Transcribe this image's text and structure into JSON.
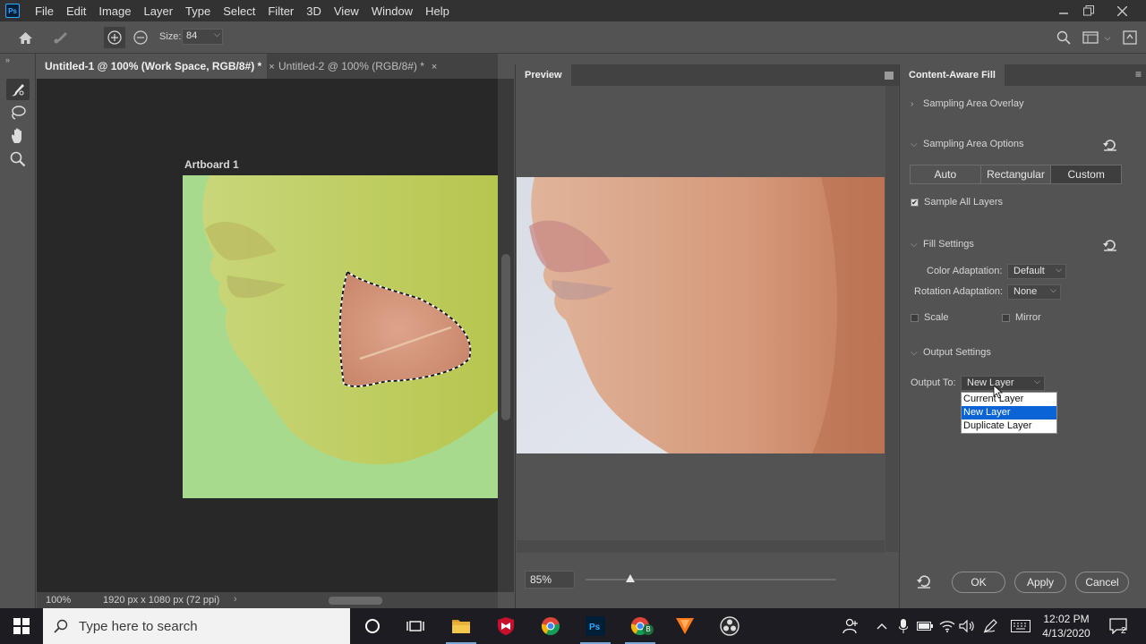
{
  "app": {
    "name": "Ps",
    "menu": [
      "File",
      "Edit",
      "Image",
      "Layer",
      "Type",
      "Select",
      "Filter",
      "3D",
      "View",
      "Window",
      "Help"
    ]
  },
  "options_bar": {
    "size_label": "Size:",
    "size_value": "84"
  },
  "document_tabs": [
    {
      "label": "Untitled-1 @ 100% (Work Space, RGB/8#) *",
      "close": "×"
    },
    {
      "label": "Untitled-2 @ 100% (RGB/8#) *",
      "close": "×"
    }
  ],
  "canvas": {
    "artboard_label": "Artboard 1"
  },
  "status_bar": {
    "zoom": "100%",
    "dimensions": "1920 px x 1080 px (72 ppi)",
    "chevron": "›"
  },
  "preview_panel": {
    "title": "Preview",
    "zoom": "85%",
    "zoom_slider_fraction": 0.18
  },
  "caf_panel": {
    "title": "Content-Aware Fill",
    "sampling_overlay": "Sampling Area Overlay",
    "sampling_options": "Sampling Area Options",
    "sampling_modes": [
      "Auto",
      "Rectangular",
      "Custom"
    ],
    "selected_mode": "Custom",
    "sample_all_layers": "Sample All Layers",
    "sample_all_layers_checked": true,
    "fill_settings": "Fill Settings",
    "color_adaptation_label": "Color Adaptation:",
    "color_adaptation_value": "Default",
    "rotation_adaptation_label": "Rotation Adaptation:",
    "rotation_adaptation_value": "None",
    "scale_label": "Scale",
    "mirror_label": "Mirror",
    "output_settings": "Output Settings",
    "output_to_label": "Output To:",
    "output_to_value": "New Layer",
    "output_options": [
      "Current Layer",
      "New Layer",
      "Duplicate Layer"
    ],
    "output_selected": "New Layer",
    "buttons": {
      "ok": "OK",
      "apply": "Apply",
      "cancel": "Cancel"
    }
  },
  "taskbar": {
    "search_placeholder": "Type here to search",
    "time": "12:02 PM",
    "date": "4/13/2020",
    "notification_count": "2",
    "chrome_badge": "B"
  },
  "colors": {
    "ps_blue": "#31a8ff",
    "selection_highlight": "#0a64d6",
    "artboard_overlay": "#9ddc7a"
  }
}
